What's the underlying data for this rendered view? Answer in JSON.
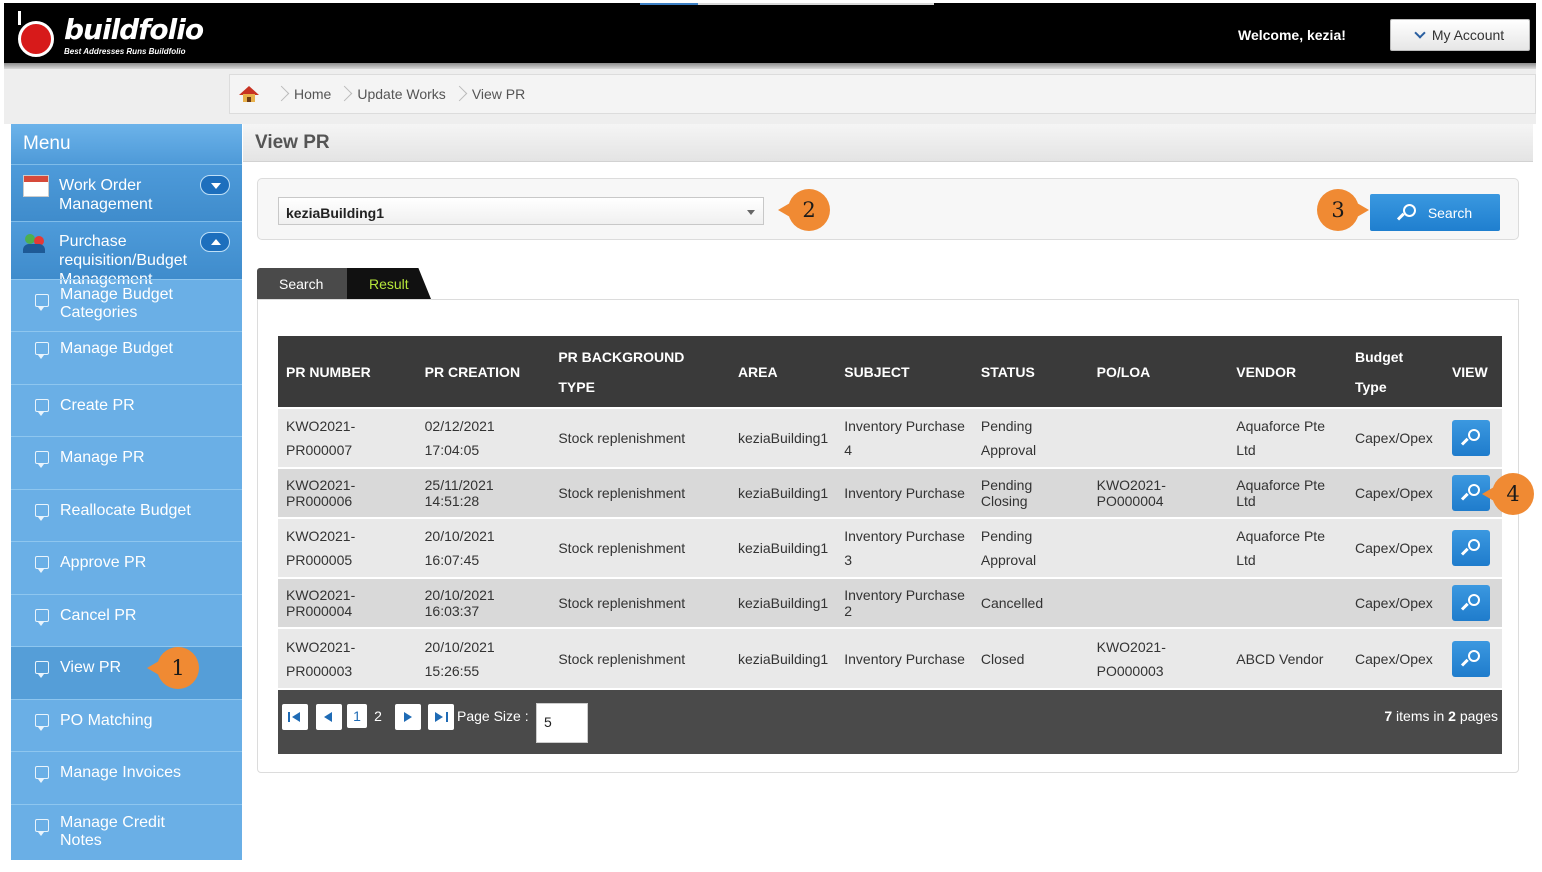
{
  "header": {
    "logo_text": "buildfolio",
    "logo_tagline": "Best Addresses Runs Buildfolio",
    "welcome": "Welcome, kezia!",
    "account_label": "My Account"
  },
  "breadcrumb": {
    "items": [
      "Home",
      "Update Works",
      "View PR"
    ]
  },
  "sidebar": {
    "title": "Menu",
    "groups": [
      {
        "label": "Work Order Management"
      },
      {
        "label": "Purchase requisition/Budget Management"
      }
    ],
    "items": [
      {
        "label": "Manage Budget Categories"
      },
      {
        "label": "Manage Budget"
      },
      {
        "label": "Create PR"
      },
      {
        "label": "Manage PR"
      },
      {
        "label": "Reallocate Budget"
      },
      {
        "label": "Approve PR"
      },
      {
        "label": "Cancel PR"
      },
      {
        "label": "View PR"
      },
      {
        "label": "PO Matching"
      },
      {
        "label": "Manage Invoices"
      },
      {
        "label": "Manage Credit Notes"
      }
    ]
  },
  "main": {
    "title": "View PR",
    "building_select": "keziaBuilding1",
    "search_button": "Search",
    "tabs": [
      {
        "label": "Search"
      },
      {
        "label": "Result"
      }
    ],
    "callouts": [
      "1",
      "2",
      "3",
      "4"
    ]
  },
  "table": {
    "headers": {
      "pr_number": "PR NUMBER",
      "pr_creation": "PR CREATION",
      "bg_type_1": "PR BACKGROUND",
      "bg_type_2": "TYPE",
      "area": "AREA",
      "subject": "SUBJECT",
      "status": "STATUS",
      "poloa": "PO/LOA",
      "vendor": "VENDOR",
      "budget_1": "Budget",
      "budget_2": "Type",
      "view": "VIEW"
    },
    "rows": [
      {
        "pr1": "KWO2021-",
        "pr2": "PR000007",
        "date": "02/12/2021",
        "time": "17:04:05",
        "bg": "Stock replenishment",
        "area": "keziaBuilding1",
        "subj1": "Inventory Purchase",
        "subj2": "4",
        "st1": "Pending",
        "st2": "Approval",
        "po1": "",
        "po2": "",
        "v1": "Aquaforce Pte",
        "v2": "Ltd",
        "budget": "Capex/Opex"
      },
      {
        "pr1": "KWO2021-",
        "pr2": "PR000006",
        "date": "25/11/2021",
        "time": "14:51:28",
        "bg": "Stock replenishment",
        "area": "keziaBuilding1",
        "subj1": "Inventory Purchase",
        "subj2": "",
        "st1": "Pending Closing",
        "st2": "",
        "po1": "KWO2021-",
        "po2": "PO000004",
        "v1": "Aquaforce Pte",
        "v2": "Ltd",
        "budget": "Capex/Opex"
      },
      {
        "pr1": "KWO2021-",
        "pr2": "PR000005",
        "date": "20/10/2021",
        "time": "16:07:45",
        "bg": "Stock replenishment",
        "area": "keziaBuilding1",
        "subj1": "Inventory Purchase",
        "subj2": "3",
        "st1": "Pending",
        "st2": "Approval",
        "po1": "",
        "po2": "",
        "v1": "Aquaforce Pte",
        "v2": "Ltd",
        "budget": "Capex/Opex"
      },
      {
        "pr1": "KWO2021-",
        "pr2": "PR000004",
        "date": "20/10/2021",
        "time": "16:03:37",
        "bg": "Stock replenishment",
        "area": "keziaBuilding1",
        "subj1": "Inventory Purchase",
        "subj2": "2",
        "st1": "Cancelled",
        "st2": "",
        "po1": "",
        "po2": "",
        "v1": "",
        "v2": "",
        "budget": "Capex/Opex"
      },
      {
        "pr1": "KWO2021-",
        "pr2": "PR000003",
        "date": "20/10/2021",
        "time": "15:26:55",
        "bg": "Stock replenishment",
        "area": "keziaBuilding1",
        "subj1": "Inventory Purchase",
        "subj2": "",
        "st1": "Closed",
        "st2": "",
        "po1": "KWO2021-",
        "po2": "PO000003",
        "v1": "ABCD Vendor",
        "v2": "",
        "budget": "Capex/Opex"
      }
    ]
  },
  "pager": {
    "pages": [
      "1",
      "2"
    ],
    "page_size_label": "Page Size :",
    "page_size": "5",
    "items_count": "7",
    "items_text": " items in ",
    "pages_count": "2",
    "pages_text": " pages"
  },
  "colors": {
    "header_bg": "#000000",
    "sidebar_bg": "#6aafe6",
    "accent_blue": "#1f7fcf",
    "callout": "#f08a33",
    "result_tab_text": "#b6e63a"
  }
}
